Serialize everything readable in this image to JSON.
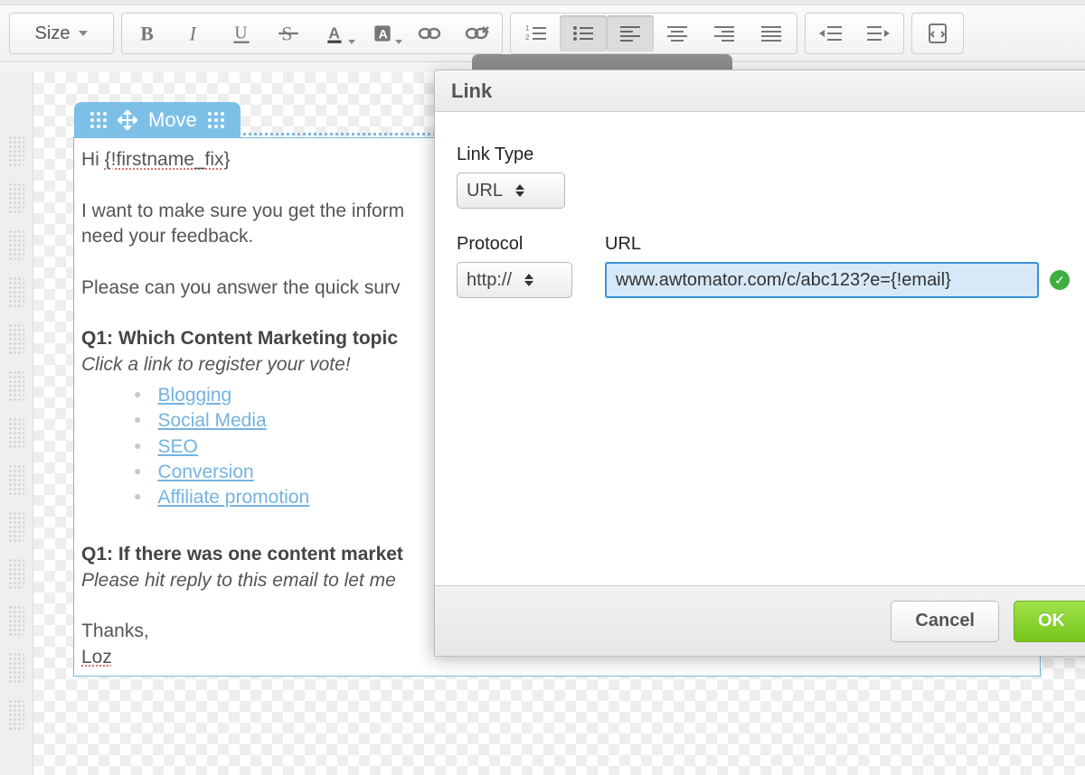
{
  "toolbar": {
    "size_label": "Size"
  },
  "email": {
    "move_label": "Move",
    "greeting_prefix": "Hi ",
    "greeting_token": "{!firstname_fix}",
    "intro_line1": "I want to make sure you get the inform",
    "intro_line2": "need your feedback.",
    "ask_line": "Please can you answer the quick surv",
    "q1_label": "Q1: Which Content Marketing topic",
    "q1_instruction": "Click a link to register your vote!",
    "links": [
      "Blogging",
      "Social Media",
      "SEO",
      "Conversion",
      "Affiliate promotion"
    ],
    "q2_label": "Q1: If there was one content market",
    "q2_instruction": "Please hit reply to this email to let me ",
    "thanks": "Thanks,",
    "sig": "Loz"
  },
  "dialog": {
    "title": "Link",
    "link_type_label": "Link Type",
    "link_type_value": "URL",
    "protocol_label": "Protocol",
    "protocol_value": "http://",
    "url_label": "URL",
    "url_value": "www.awtomator.com/c/abc123?e={!email}",
    "cancel": "Cancel",
    "ok": "OK"
  }
}
